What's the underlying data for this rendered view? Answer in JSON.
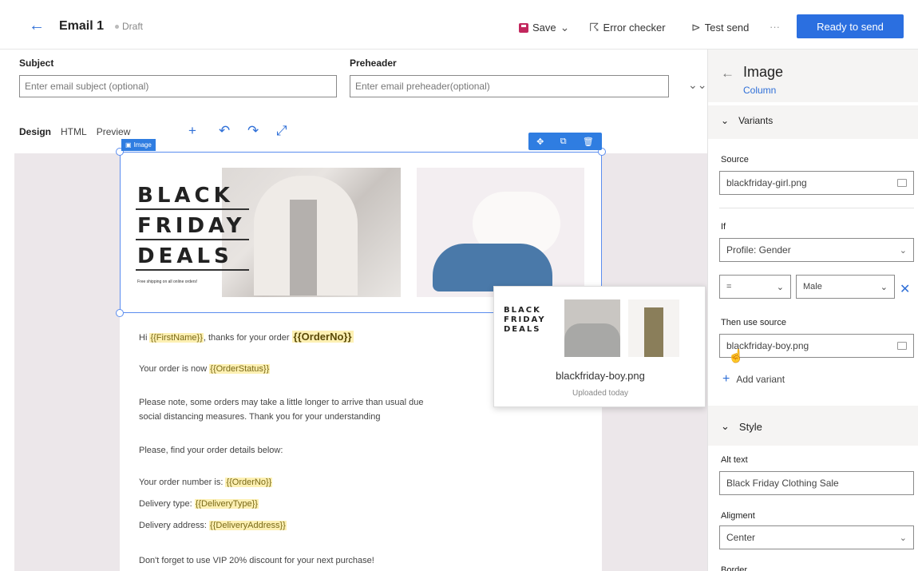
{
  "header": {
    "title": "Email 1",
    "status": "Draft",
    "save_label": "Save",
    "error_checker_label": "Error checker",
    "test_send_label": "Test send",
    "more_label": "···",
    "ready_label": "Ready to send"
  },
  "fields": {
    "subject_label": "Subject",
    "subject_placeholder": "Enter email subject (optional)",
    "preheader_label": "Preheader",
    "preheader_placeholder": "Enter email preheader(optional)"
  },
  "tabs": [
    "Design",
    "HTML",
    "Preview"
  ],
  "image_chip": "Image",
  "banner": {
    "line1": "BLACK",
    "line2": "FRIDAY",
    "line3": "DEALS",
    "tagline": "Free shipping on all online orders!"
  },
  "body": {
    "greeting_pre": "Hi ",
    "first_name_tag": "{{FirstName}}",
    "greeting_mid": ", thanks for your order ",
    "order_no_tag": "{{OrderNo}}",
    "status_pre": "Your order is now ",
    "order_status_tag": "{{OrderStatus}}",
    "note_line1": "Please note, some orders may take a little longer to arrive than usual due",
    "note_line2": "social distancing measures. Thank you for your understanding",
    "details": "Please, find your order details below:",
    "order_number_pre": "Your order number is: ",
    "order_number_tag": "{{OrderNo}}",
    "delivery_type_pre": "Delivery type: ",
    "delivery_type_tag": "{{DeliveryType}}",
    "delivery_address_pre": "Delivery address: ",
    "delivery_address_tag": "{{DeliveryAddress}}",
    "discount": "Don't forget to use VIP 20% discount for your next purchase!"
  },
  "popover": {
    "bf1": "BLACK",
    "bf2": "FRIDAY",
    "bf3": "DEALS",
    "file_name": "blackfriday-boy.png",
    "uploaded": "Uploaded today"
  },
  "panel": {
    "title": "Image",
    "subtitle": "Column",
    "variants_label": "Variants",
    "source_label": "Source",
    "source_value": "blackfriday-girl.png",
    "if_label": "If",
    "if_value": "Profile: Gender",
    "operator_value": "=",
    "gender_value": "Male",
    "then_label": "Then use source",
    "then_value": "blackfriday-boy.png",
    "add_variant": "Add variant",
    "style_label": "Style",
    "alt_label": "Alt text",
    "alt_value": "Black Friday Clothing Sale",
    "alignment_label": "Aligment",
    "alignment_value": "Center",
    "border_label": "Border"
  }
}
